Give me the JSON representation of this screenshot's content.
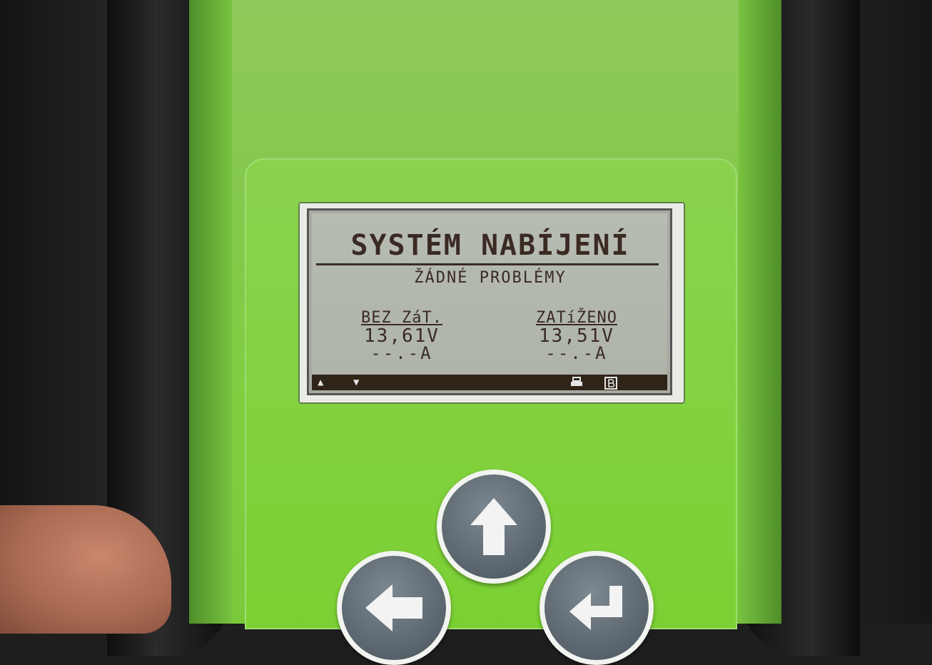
{
  "device": {
    "screen": {
      "title": "SYSTÉM NABÍJENÍ",
      "status": "ŽÁDNÉ PROBLÉMY",
      "columns": [
        {
          "heading": "BEZ ZáT.",
          "voltage": "13,61V",
          "current": "--.-A"
        },
        {
          "heading": "ZATíŽENO",
          "voltage": "13,51V",
          "current": "--.-A"
        }
      ],
      "bar": {
        "left_icons": [
          "up-triangle-icon",
          "down-triangle-icon"
        ],
        "right_icons": [
          "print-icon",
          "battery-b-icon"
        ]
      }
    },
    "buttons": [
      {
        "name": "up-arrow-button",
        "icon": "arrow-up-icon"
      },
      {
        "name": "left-arrow-button",
        "icon": "arrow-left-icon"
      },
      {
        "name": "enter-button",
        "icon": "enter-icon"
      }
    ],
    "colors": {
      "housing_green": "#7fcf3e",
      "lcd_background": "#b4b9ae",
      "lcd_text": "#3a2a22",
      "button_gray": "#5f6a72"
    }
  }
}
